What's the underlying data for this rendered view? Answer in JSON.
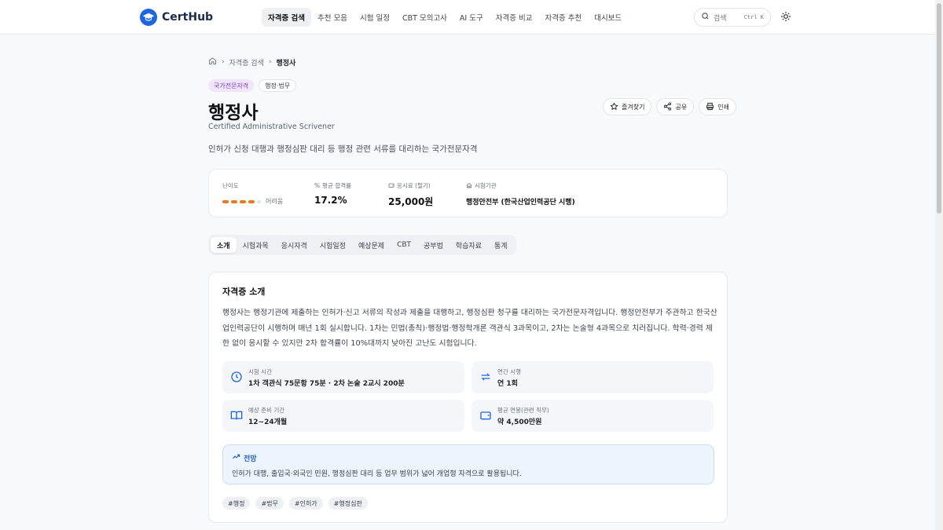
{
  "app": {
    "name": "CertHub"
  },
  "nav": {
    "items": [
      {
        "label": "자격증 검색",
        "active": true
      },
      {
        "label": "추천 모음"
      },
      {
        "label": "시험 일정"
      },
      {
        "label": "CBT 모의고사"
      },
      {
        "label": "AI 도구"
      },
      {
        "label": "자격증 비교"
      },
      {
        "label": "자격증 추천"
      },
      {
        "label": "대시보드"
      }
    ]
  },
  "search": {
    "placeholder": "검색",
    "shortcut": "Ctrl K"
  },
  "breadcrumb": {
    "parent": "자격증 검색",
    "current": "행정사"
  },
  "badges": {
    "category": "국가전문자격",
    "field": "행정·법무"
  },
  "cert": {
    "title": "행정사",
    "subtitle": "Certified Administrative Scrivener",
    "description": "인허가 신청 대행과 행정심판 대리 등 행정 관련 서류를 대리하는 국가전문자격"
  },
  "actions": {
    "favorite": "즐겨찾기",
    "share": "공유",
    "print": "인쇄"
  },
  "stats": {
    "difficulty": {
      "label": "난이도",
      "level_text": "어려움",
      "filled": 4,
      "total": 5
    },
    "pass_rate": {
      "label": "평균 합격률",
      "value": "17.2%"
    },
    "fee": {
      "label": "응시료 (필기)",
      "value": "25,000원"
    },
    "agency": {
      "label": "시험기관",
      "value": "행정안전부 (한국산업인력공단 시행)"
    }
  },
  "tabs": [
    {
      "label": "소개",
      "active": true
    },
    {
      "label": "시험과목"
    },
    {
      "label": "응시자격"
    },
    {
      "label": "시험일정"
    },
    {
      "label": "예상문제"
    },
    {
      "label": "CBT"
    },
    {
      "label": "공부법"
    },
    {
      "label": "학습자료"
    },
    {
      "label": "통계"
    }
  ],
  "intro": {
    "title": "자격증 소개",
    "body": "행정사는 행정기관에 제출하는 인허가·신고 서류의 작성과 제출을 대행하고, 행정심판 청구를 대리하는 국가전문자격입니다. 행정안전부가 주관하고 한국산업인력공단이 시행하며 매년 1회 실시합니다. 1차는 민법(총칙)·행정법·행정학개론 객관식 3과목이고, 2차는 논술형 4과목으로 치러집니다. 학력·경력 제한 없이 응시할 수 있지만 2차 합격률이 10%대까지 낮아진 고난도 시험입니다.",
    "info": [
      {
        "label": "시험 시간",
        "value": "1차 객관식 75문항 75분 · 2차 논술 2교시 200분",
        "icon": "clock-icon"
      },
      {
        "label": "연간 시행",
        "value": "연 1회",
        "icon": "repeat-icon"
      },
      {
        "label": "예상 준비 기간",
        "value": "12~24개월",
        "icon": "book-icon"
      },
      {
        "label": "평균 연봉(관련 직무)",
        "value": "약 4,500만원",
        "icon": "wallet-icon"
      }
    ],
    "outlook": {
      "title": "전망",
      "text": "인허가 대행, 출입국·외국인 민원, 행정심판 대리 등 업무 범위가 넓어 개업형 자격으로 활용됩니다."
    },
    "tags": [
      "#행정",
      "#법무",
      "#인허가",
      "#행정심판"
    ]
  },
  "colors": {
    "accent": "#1f64e0",
    "difficulty": "#e67a22",
    "purple_badge": "#7a3fc1"
  }
}
